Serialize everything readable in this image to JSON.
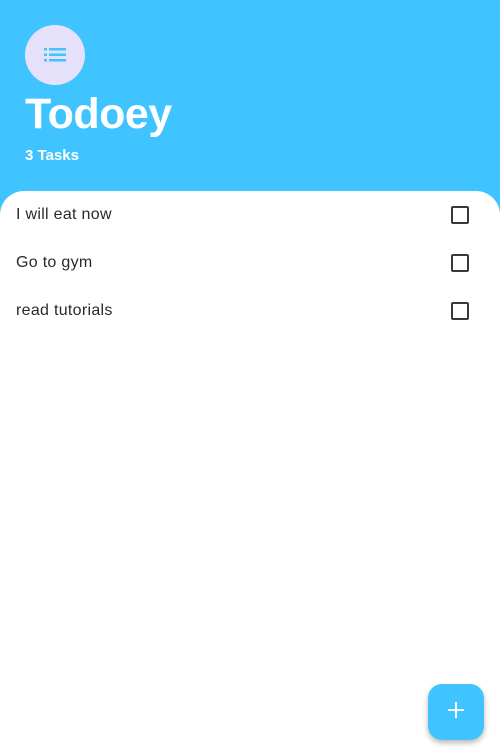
{
  "header": {
    "logo_icon": "list-icon",
    "title": "Todoey",
    "task_count": "3 Tasks"
  },
  "tasks": [
    {
      "label": "I will eat now",
      "checked": false
    },
    {
      "label": "Go to gym",
      "checked": false
    },
    {
      "label": "read tutorials",
      "checked": false
    }
  ],
  "fab": {
    "icon": "plus-icon"
  },
  "colors": {
    "accent": "#40C4FF",
    "logo_bg": "#E6E1FB",
    "sheet_bg": "#FFFFFF",
    "text": "#2A2A2A"
  }
}
